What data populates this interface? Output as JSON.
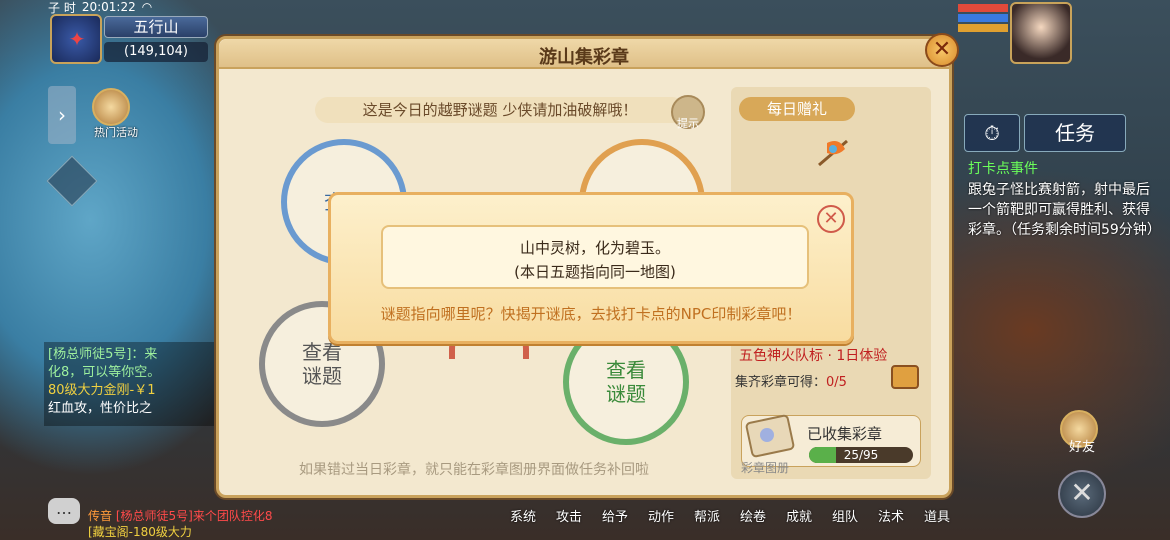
{
  "hud": {
    "time_label": "子 时",
    "clock": "20:01:22",
    "map_name": "五行山",
    "coords": "(149,104)",
    "hot_activity": "热门活动",
    "friends": "好友"
  },
  "chat": {
    "line1": "[杨总师徒5号]：来",
    "line2": "化8，可以等你空。",
    "line3": "80级大力金刚-￥1",
    "line4": "红血攻，性价比之",
    "bottom_tag": "传音",
    "bottom_text1": "[杨总师徒5号]来个团队控化8",
    "bottom_text2": "[藏宝阁-180级大力"
  },
  "task": {
    "tab_label": "任务",
    "title": "打卡点事件",
    "description": "跟兔子怪比赛射箭，射中最后一个箭靶即可赢得胜利、获得彩章。（任务剩余时间59分钟）"
  },
  "toolbar": {
    "items": [
      "系统",
      "攻击",
      "给予",
      "动作",
      "帮派",
      "绘卷",
      "成就",
      "组队",
      "法术",
      "道具"
    ]
  },
  "panel": {
    "title": "游山集彩章",
    "riddle_banner": "这是今日的越野谜题 少侠请加油破解哦！",
    "hint": "提示",
    "view_riddle": "查看谜题",
    "view_riddle_partial": "查看",
    "footer": "如果错过当日彩章，就只能在彩章图册界面做任务补回啦",
    "daily_gift": "每日赠礼",
    "reward_name": "五色神火队标 · 1日体验",
    "collect_label": "集齐彩章可得：",
    "collect_value": "0/5",
    "stamp_book": "彩章图册",
    "collected_label": "已收集彩章",
    "collected_value": "25/95",
    "collected_fraction": 0.263
  },
  "popup": {
    "line1": "山中灵树，化为碧玉。",
    "line2": "(本日五题指向同一地图)",
    "hint": "谜题指向哪里呢？快揭开谜底，去找打卡点的NPC印制彩章吧！"
  }
}
